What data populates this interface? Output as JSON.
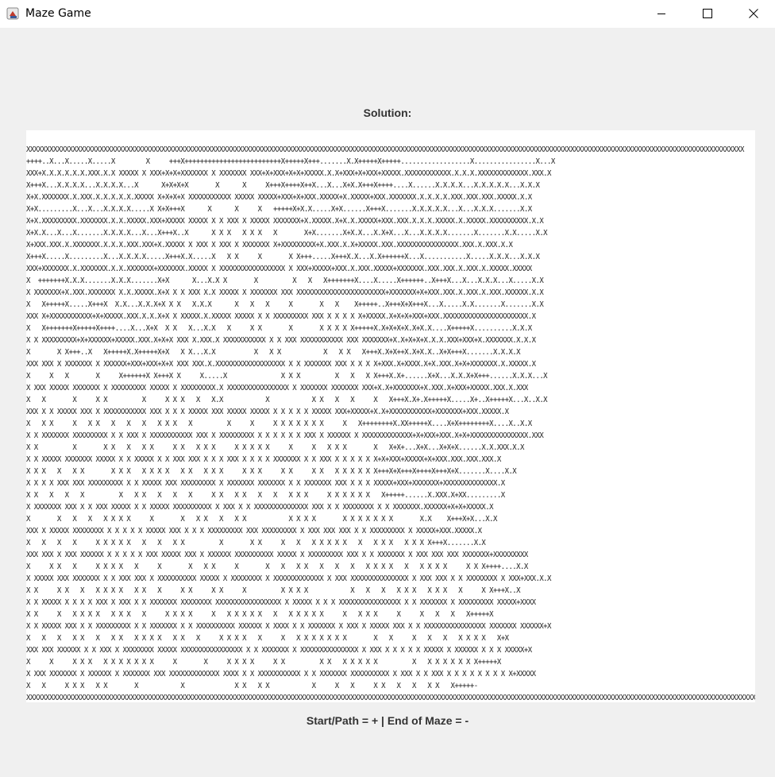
{
  "window": {
    "title": "Maze Game",
    "icons": {
      "app": "java-cup-icon",
      "minimize": "minimize-icon",
      "maximize": "maximize-icon",
      "close": "close-icon"
    }
  },
  "solution_label": "Solution:",
  "maze_lines": [
    "XXXXXXXXXXXXXXXXXXXXXXXXXXXXXXXXXXXXXXXXXXXXXXXXXXXXXXXXXXXXXXXXXXXXXXXXXXXXXXXXXXXXXXXXXXXXXXXXXXXXXXXXXXXXXXXXXXXXXXXXXXXXXXXXXXXXXXXXXXXXXXXXXXXXXXXXXXXXXXXXXXXXXXXXXXXXXXXXXXXXXXXXXX",
    "++++..X...X.....X.....X        X     +++X+++++++++++++++++++++++++X+++++X+++.......X.X+++++X+++++..................X................X...X",
    "XXX+X.X.X.X.X.X.XXX.X.X XXXXX X XXX+X+X+XXXXXXX X XXXXXXX XXX+X+XXX+X+X+XXXXX.X.X+XXX+X+XXX+XXXXX.XXXXXXXXXXXX.X.X.X.XXXXXXXXXXXXX.XXX.X",
    "X+++X...X.X.X.X...X.X.X.X...X      X+X+X+X       X      X     X+++X++++X++X...X...X+X.X+++X++++....X......X.X.X.X...X.X.X.X.X...X.X.X",
    "X+X.XXXXXXX.X.XXX.X.X.X.X.X.XXXXX X+X+X+X XXXXXXXXXXX XXXXX XXXXX+XXX+X+XXX.XXXXX+X.XXXXX+XXX.XXXXXXX.X.X.X.X.XXX.XXX.XXX.XXXXX.X.X",
    "X+X.........X...X...X.X.X.X.....X X+X+++X      X      X     X   +++++X+X.X.....X+X......X+++X.......X.X.X.X.X...X...X.X.X.......X.X",
    "X+X.XXXXXXXXX.XXXXXXX.X.X.XXXXX.XXX+XXXXX XXXXX X X XXX X XXXXX XXXXXXX+X.XXXXX.X+X.X.XXXXX+XXX.XXX.X.X.X.XXXXX.X.XXXXX.XXXXXXXXXX.X.X",
    "X+X.X...X...X.......X.X.X.X...X...X+++X..X      X X X   X X X   X       X+X.......X+X.X...X.X+X...X...X.X.X.X.......X.......X.X.....X.X",
    "X+XXX.XXX.X.XXXXXXX.X.X.X.XXX.XXX+X.XXXXX X XXX X XXX X XXXXXXX X+XXXXXXXXX+X.XXX.X.X+XXXXX.XXX.XXXXXXXXXXXXXXXX.XXX.X.XXX.X.X",
    "X+++X.....X.........X...X.X.X.X.....X+++X.X.....X   X X     X       X X+++.....X+++X.X...X.X++++++X...X...........X.....X.X.X...X.X.X",
    "XXX+XXXXXXX.X.XXXXXXX.X.X.XXXXXXX+XXXXXXX.XXXXX X XXXXXXXXXXXXXXXXX X XXX+XXXXX+XXX.X.XXX.XXXXX+XXXXXXX.XXX.XXX.X.XXX.X.XXXXX.XXXXX",
    "X  +++++++X.X.X.......X.X.X.......X+X      X...X.X X       X         X   X   X+++++++X....X.....X++++++..X+++X...X...X.X.X...X.....X.X",
    "X XXXXXXX+X.XXX.XXXXXXX X.X.XXXXX.X+X X X XXX X.X XXXXX X XXXXXXX XXX XXXXXXXXXXXXXXXXXXXXXXX+XXXXXXX+X+XXX.XXX.X.XXX.X.XXX.XXXXXX.X.X",
    "X   X+++++X.....X+++X  X.X...X.X.X+X X X   X.X.X      X   X   X     X       X   X    X+++++..X+++X+X+++X...X.....X.X.......X.......X.X",
    "XXX X+XXXXXXXXXXX+X+XXXXX.XXX.X.X.X+X X XXXXX.X.XXXXX XXXXX X X XXXXXXXXX XXX X X X X X+XXXXX.X+X+X+XXX+XXX.XXXXXXXXXXXXXXXXXXXXXX.X",
    "X   X+++++++X+++++X++++....X...X+X  X X   X...X.X   X     X X       X       X X X X X+++++X.X+X+X+X.X+X.X....X+++++X..........X.X.X",
    "X X XXXXXXXXX+X+XXXXXX+XXXXX.XXX.X+X+X XXX X.XXX.X XXXXXXXXXXX X X XXX XXXXXXXXXXX XXX XXXXXXX+X.X+X+X+X.X.X.XXX+XXX+X.XXXXXXX.X.X.X",
    "X       X X+++..X   X+++++X.X+++++X+X   X X...X.X          X   X X           X   X X   X+++X.X+X++X.X+X.X..X+X+++X.......X.X.X.X",
    "XXX XXX X XXXXXXX X XXXXXX+XXX+XXX+X+X XXX XXX.X.XXXXXXXXXXXXXXXXXX X X XXXXXXX XXX X X X X+XXX.X+XXXX.X+X.XXX.X+X+XXXXXXX.X.XXXXX.X",
    "X     X   X       X     X++++++X X+++X X     X.....X              X X X         X   X   X X+++X.X+......X+X...X.X.X+X+++......X.X.X...X",
    "X XXX XXXXX XXXXXXX X XXXXXXXXX XXXXX X XXXXXXXXX.X XXXXXXXXXXXXXXXX X XXXXXXX XXXXXXX XXX+X.X+XXXXXXX+X.XXX.X+XXX+XXXXX.XXX.X.XXX",
    "X   X       X     X X         X     X X X   X   X.X           X           X X   X   X     X   X+++X.X+.X+++++X.....X+..X+++++X...X..X.X",
    "XXX X X XXXXX XXX X XXXXXXXXXXX XXX X X X XXXXX XXX XXXXX XXXXX X X X X X XXXXX XXX+XXXXX+X.X+XXXXXXXXXXX+XXXXXXX+XXX.XXXXX.X",
    "X   X X     X   X X   X   X   X   X X X   X         X     X     X X X X X X X     X   X++++++++X.XX+++++X....X+X++++++++X....X..X.X",
    "X X XXXXXXX XXXXXXXXX X X XXX X XXXXXXXXXXX XXX X XXXXXXXXX X X X X X X XXX X XXXXXX X XXXXXXXXXXXXX+X+XXX+XXX.X+X+XXXXXXXXXXXXXXX.XXX",
    "X X         X       X X   X   X X     X X   X X X     X X X X X     X     X   X X X       X   X+X+...X+X...X+X+X......X.X.XXX.X.X",
    "X X XXXXX XXXXXXX XXXXX X X XXXXX X X XXX XXX X X X XXX X X X X XXXXXXX X X XXX X X X X X X+X+XXX+XXXXX+X+XXX.XXX.XXX.XXX.X",
    "X X X   X   X X       X X X   X X X X   X X   X X X     X X X     X X     X X   X X X X X X+++X+X+++X++++X+++X+X.......X....X.X",
    "X X X X XXX XXX XXXXXXXXX X X XXXXX XXX XXXXXXXXX X XXXXXXX XXXXXXX X X XXXXXXX XXX X X X XXXXX+XXX+XXXXXXX+XXXXXXXXXXXXXX.X",
    "X X   X   X   X         X   X X   X   X   X     X X   X X   X   X   X X X     X X X X X X   X+++++......X.XXX.X+XX.........X",
    "X XXXXXXX XXX X X XXX XXXXX X X XXXXX XXXXXXXXXX X XXX X X XXXXXXXXXXXXXX XXX X X XXXXXXXX X X XXXXXXX.XXXXXX+X+X+XXXXX.X",
    "X       X   X   X   X X X X     X       X   X X   X   X X           X X X X       X X X X X X X       X.X    X+++X+X...X.X",
    "XXX X XXXXX XXXXXXXX X X X X X XXXXX XXX X X X XXXXXXXXX XXX XXXXXXXXX X XXX XXX XXX X X XXXXXXXXX X XXXXX+XXX.XXXXX.X",
    "X   X   X   X     X X X X X   X   X   X X         X       X X     X   X   X X X X X   X   X X X   X X X X+++X.......X.X",
    "XXX XXX X XXX XXXXXX X X X X X XXX XXXXX XXX X XXXXXX XXXXXXXXXX XXXXX X XXXXXXXXX XXX X X XXXXXXX X XXX XXX XXX XXXXXXX+XXXXXXXXX",
    "X     X X   X     X X X X   X     X       X   X X     X       X   X   X X   X   X   X   X X X X   X   X X X X     X X X++++....X.X",
    "X XXXXX XXX XXXXXXX X X XXX XXX X XXXXXXXXXX XXXXX X XXXXXXXX X XXXXXXXXXXXXX X XXX XXXXXXXXXXXXXXX X XXX XXX X X XXXXXXXX X XXX+XXX.X.X",
    "X X     X X   X   X X X X   X X   X     X X     X X     X         X X X X           X   X   X   X X X   X X X   X     X X+++X..X",
    "X X XXXXX X X X X XXX X XXX X X XXXXXXX XXXXXXXX XXXXXXXXXXXXXXXXX X XXXXX X X X XXXXXXXXXXXXXXXX X X XXXXXXX X XXXXXXXXX XXXXX+XXXX",
    "X X     X   X X X X   X X X   X     X X X X     X   X X X X X   X   X X X X X     X   X X X     X     X   X   X   X+++++X",
    "X X XXXXX XXX X X XXXXXXXXX X X XXXXXXX X X XXXXXXXXXX XXXXXX X XXXX X X XXXXXXX X XXX X XXXXX XXX X X XXXXXXXXXXXXXXXX XXXXXXX XXXXXX+X",
    "X   X   X   X X   X   X X   X X X X   X X   X     X X X X   X     X   X X X X X X X       X   X     X   X   X   X X X X   X+X",
    "XXX XXX XXXXXX X X XXX X XXXXXXXX XXXXX XXXXXXXXXXXXXXXX X X XXXXXXX X XXXXXXXXXXXXXXX X XXX X X X X X XXXXX X XXXXXX X X X XXXXX+X",
    "X     X     X X X   X X X X X X X     X       X     X X X X     X X         X X   X X X X X         X   X X X X X X X+++++X",
    "X XXX XXXXXXX X XXXXXX X XXXXXXX XXX XXXXXXXXXXXXX XXXX X X XXXXXXXXXXX X X XXXXXXX XXXXXXXXXX X XXX X X XXX X X X X X X X X X+XXXXX",
    "X   X     X X X   X X       X           X             X X   X X           X     X   X     X X   X   X   X X   X+++++-",
    "XXXXXXXXXXXXXXXXXXXXXXXXXXXXXXXXXXXXXXXXXXXXXXXXXXXXXXXXXXXXXXXXXXXXXXXXXXXXXXXXXXXXXXXXXXXXXXXXXXXXXXXXXXXXXXXXXXXXXXXXXXXXXXXXXXXXXXXXXXXXXXXXXXXXXXXXXXXXXXXXXXXXXXXXXXXXXXXXXXXXXXXXXXXXX"
  ],
  "legend": "Start/Path = + | End of Maze = -"
}
